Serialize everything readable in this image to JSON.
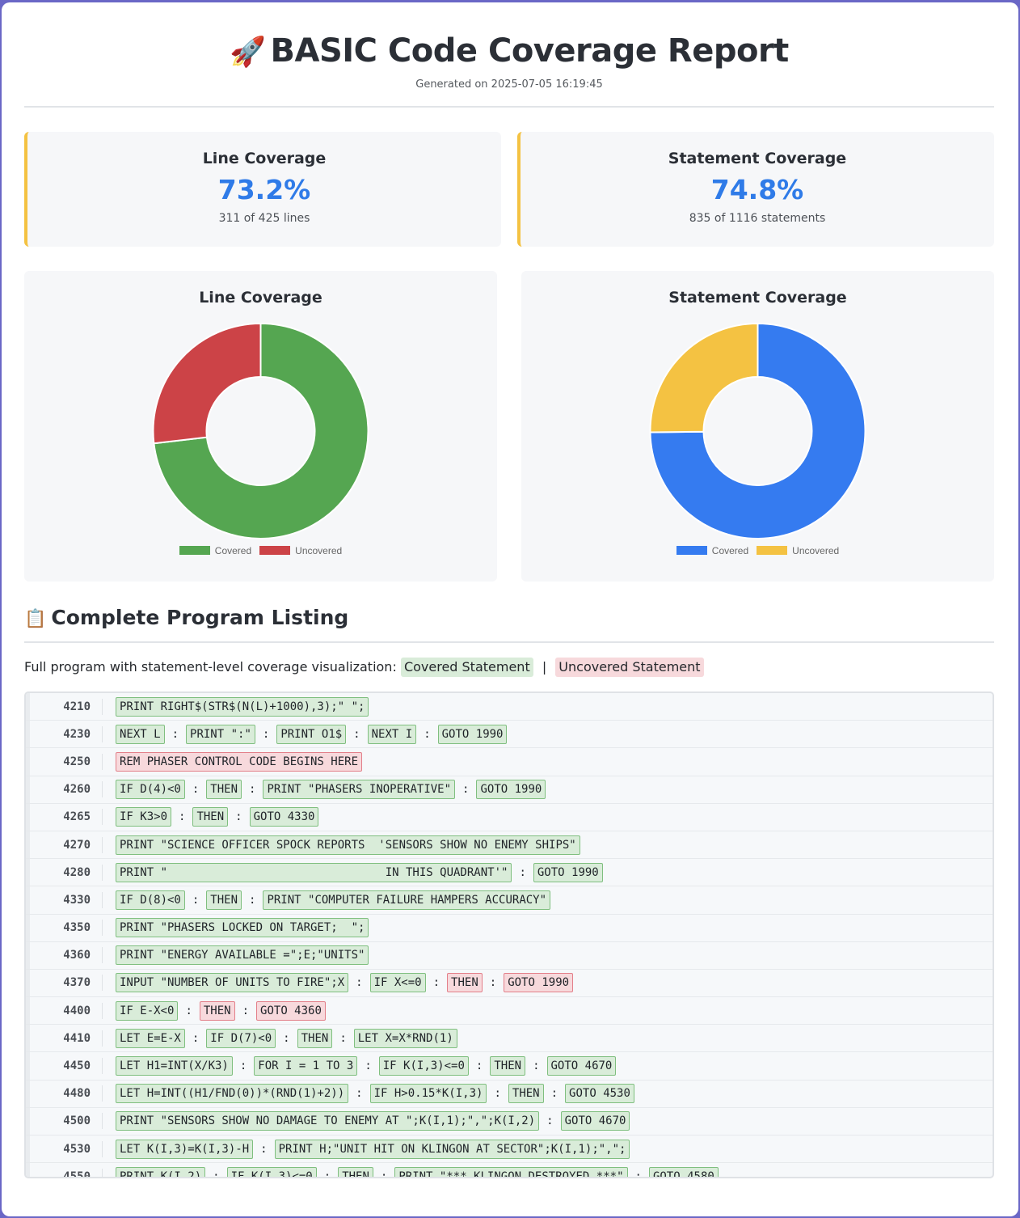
{
  "header": {
    "icon": "rocket-icon",
    "title": "BASIC Code Coverage Report",
    "subtitle": "Generated on 2025-07-05 16:19:45"
  },
  "stats": {
    "line": {
      "title": "Line Coverage",
      "value": "73.2%",
      "detail": "311 of 425 lines"
    },
    "statement": {
      "title": "Statement Coverage",
      "value": "74.8%",
      "detail": "835 of 1116 statements"
    }
  },
  "chart_data": [
    {
      "type": "pie",
      "donut": true,
      "title": "Line Coverage",
      "labels": [
        "Covered",
        "Uncovered"
      ],
      "values": [
        311,
        114
      ],
      "colors": [
        "#55a651",
        "#cc4347"
      ],
      "legend": "bottom"
    },
    {
      "type": "pie",
      "donut": true,
      "title": "Statement Coverage",
      "labels": [
        "Covered",
        "Uncovered"
      ],
      "values": [
        835,
        281
      ],
      "colors": [
        "#357bf0",
        "#f4c242"
      ],
      "legend": "bottom"
    }
  ],
  "listing": {
    "icon": "clipboard-icon",
    "title": "Complete Program Listing",
    "description": "Full program with statement-level coverage visualization:",
    "covered_label": "Covered Statement",
    "separator": "|",
    "uncovered_label": "Uncovered Statement",
    "lines": [
      {
        "num": "4210",
        "stmts": [
          {
            "t": "PRINT RIGHT$(STR$(N(L)+1000),3);\" \";",
            "c": true
          }
        ]
      },
      {
        "num": "4230",
        "stmts": [
          {
            "t": "NEXT L",
            "c": true
          },
          {
            "t": "PRINT \":\"",
            "c": true
          },
          {
            "t": "PRINT O1$",
            "c": true
          },
          {
            "t": "NEXT I",
            "c": true
          },
          {
            "t": "GOTO 1990",
            "c": true
          }
        ]
      },
      {
        "num": "4250",
        "stmts": [
          {
            "t": "REM PHASER CONTROL CODE BEGINS HERE",
            "c": false
          }
        ]
      },
      {
        "num": "4260",
        "stmts": [
          {
            "t": "IF D(4)<0",
            "c": true
          },
          {
            "t": "THEN",
            "c": true
          },
          {
            "t": "PRINT \"PHASERS INOPERATIVE\"",
            "c": true
          },
          {
            "t": "GOTO 1990",
            "c": true
          }
        ]
      },
      {
        "num": "4265",
        "stmts": [
          {
            "t": "IF K3>0",
            "c": true
          },
          {
            "t": "THEN",
            "c": true
          },
          {
            "t": "GOTO 4330",
            "c": true
          }
        ]
      },
      {
        "num": "4270",
        "stmts": [
          {
            "t": "PRINT \"SCIENCE OFFICER SPOCK REPORTS  'SENSORS SHOW NO ENEMY SHIPS\"",
            "c": true
          }
        ]
      },
      {
        "num": "4280",
        "stmts": [
          {
            "t": "PRINT \"                                IN THIS QUADRANT'\"",
            "c": true
          },
          {
            "t": "GOTO 1990",
            "c": true
          }
        ]
      },
      {
        "num": "4330",
        "stmts": [
          {
            "t": "IF D(8)<0",
            "c": true
          },
          {
            "t": "THEN",
            "c": true
          },
          {
            "t": "PRINT \"COMPUTER FAILURE HAMPERS ACCURACY\"",
            "c": true
          }
        ]
      },
      {
        "num": "4350",
        "stmts": [
          {
            "t": "PRINT \"PHASERS LOCKED ON TARGET;  \";",
            "c": true
          }
        ]
      },
      {
        "num": "4360",
        "stmts": [
          {
            "t": "PRINT \"ENERGY AVAILABLE =\";E;\"UNITS\"",
            "c": true
          }
        ]
      },
      {
        "num": "4370",
        "stmts": [
          {
            "t": "INPUT \"NUMBER OF UNITS TO FIRE\";X",
            "c": true
          },
          {
            "t": "IF X<=0",
            "c": true
          },
          {
            "t": "THEN",
            "c": false
          },
          {
            "t": "GOTO 1990",
            "c": false
          }
        ]
      },
      {
        "num": "4400",
        "stmts": [
          {
            "t": "IF E-X<0",
            "c": true
          },
          {
            "t": "THEN",
            "c": false
          },
          {
            "t": "GOTO 4360",
            "c": false
          }
        ]
      },
      {
        "num": "4410",
        "stmts": [
          {
            "t": "LET E=E-X",
            "c": true
          },
          {
            "t": "IF D(7)<0",
            "c": true
          },
          {
            "t": "THEN",
            "c": true
          },
          {
            "t": "LET X=X*RND(1)",
            "c": true
          }
        ]
      },
      {
        "num": "4450",
        "stmts": [
          {
            "t": "LET H1=INT(X/K3)",
            "c": true
          },
          {
            "t": "FOR I = 1 TO 3",
            "c": true
          },
          {
            "t": "IF K(I,3)<=0",
            "c": true
          },
          {
            "t": "THEN",
            "c": true
          },
          {
            "t": "GOTO 4670",
            "c": true
          }
        ]
      },
      {
        "num": "4480",
        "stmts": [
          {
            "t": "LET H=INT((H1/FND(0))*(RND(1)+2))",
            "c": true
          },
          {
            "t": "IF H>0.15*K(I,3)",
            "c": true
          },
          {
            "t": "THEN",
            "c": true
          },
          {
            "t": "GOTO 4530",
            "c": true
          }
        ]
      },
      {
        "num": "4500",
        "stmts": [
          {
            "t": "PRINT \"SENSORS SHOW NO DAMAGE TO ENEMY AT \";K(I,1);\",\";K(I,2)",
            "c": true
          },
          {
            "t": "GOTO 4670",
            "c": true
          }
        ]
      },
      {
        "num": "4530",
        "stmts": [
          {
            "t": "LET K(I,3)=K(I,3)-H",
            "c": true
          },
          {
            "t": "PRINT H;\"UNIT HIT ON KLINGON AT SECTOR\";K(I,1);\",\";",
            "c": true
          }
        ]
      },
      {
        "num": "4550",
        "stmts": [
          {
            "t": "PRINT K(I,2)",
            "c": true
          },
          {
            "t": "IF K(I,3)<=0",
            "c": true
          },
          {
            "t": "THEN",
            "c": true
          },
          {
            "t": "PRINT \"*** KLINGON DESTROYED ***\"",
            "c": true
          },
          {
            "t": "GOTO 4580",
            "c": true
          }
        ]
      }
    ]
  }
}
